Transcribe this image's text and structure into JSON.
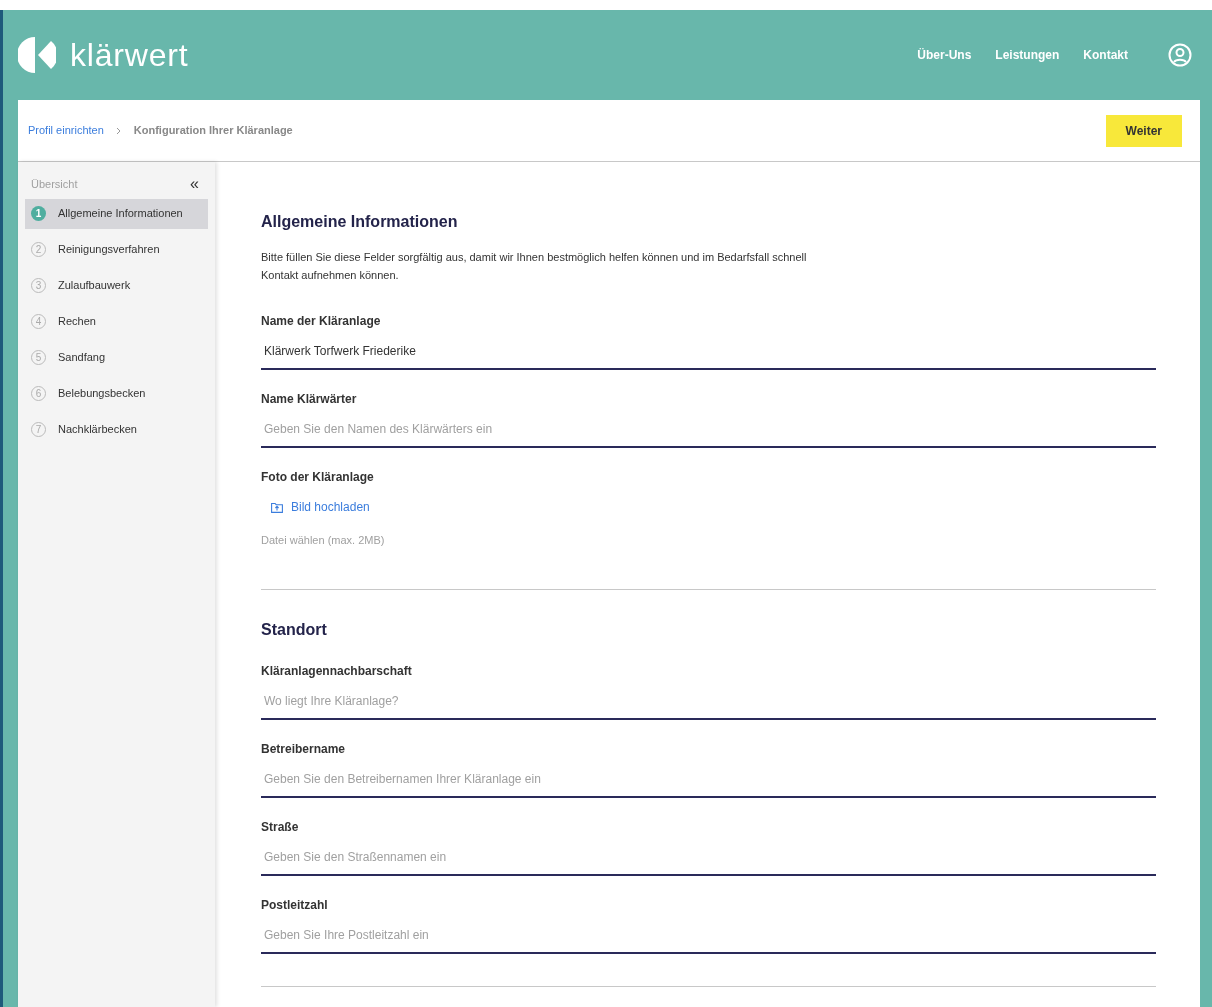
{
  "header": {
    "logo_text": "klärwert",
    "nav": [
      "Über-Uns",
      "Leistungen",
      "Kontakt"
    ]
  },
  "breadcrumb": [
    "Profil einrichten",
    "Konfiguration Ihrer Kläranlage"
  ],
  "next_button": "Weiter",
  "sidebar": {
    "title": "Übersicht",
    "collapse_icon": "«",
    "steps": [
      {
        "number": "1",
        "label": "Allgemeine Informationen",
        "selected": true
      },
      {
        "number": "2",
        "label": "Reinigungsverfahren",
        "selected": false
      },
      {
        "number": "3",
        "label": "Zulaufbauwerk",
        "selected": false
      },
      {
        "number": "4",
        "label": "Rechen",
        "selected": false
      },
      {
        "number": "5",
        "label": "Sandfang",
        "selected": false
      },
      {
        "number": "6",
        "label": "Belebungsbecken",
        "selected": false
      },
      {
        "number": "7",
        "label": "Nachklärbecken",
        "selected": false
      }
    ]
  },
  "sections": [
    {
      "title": "Allgemeine Informationen",
      "intro": "Bitte füllen Sie diese Felder sorgfältig aus, damit wir Ihnen bestmöglich helfen können und im Bedarfsfall schnell Kontakt aufnehmen können.",
      "fields": [
        {
          "kind": "text",
          "label": "Name der Kläranlage",
          "value": "Klärwerk Torfwerk Friederike"
        },
        {
          "kind": "text",
          "label": "Name Klärwärter",
          "placeholder": "Geben Sie den Namen des Klärwärters ein"
        },
        {
          "kind": "upload",
          "label": "Foto der Kläranlage",
          "button": "Bild hochladen",
          "hint": "Datei wählen (max. 2MB)"
        }
      ]
    },
    {
      "title": "Standort",
      "fields": [
        {
          "kind": "text",
          "label": "Kläranlagennachbarschaft",
          "placeholder": "Wo liegt Ihre Kläranlage?"
        },
        {
          "kind": "text",
          "label": "Betreibername",
          "placeholder": "Geben Sie den Betreibernamen Ihrer Kläranlage ein"
        },
        {
          "kind": "text",
          "label": "Straße",
          "placeholder": "Geben Sie den Straßennamen ein"
        },
        {
          "kind": "text",
          "label": "Postleitzahl",
          "placeholder": "Geben Sie Ihre Postleitzahl ein"
        }
      ]
    }
  ]
}
